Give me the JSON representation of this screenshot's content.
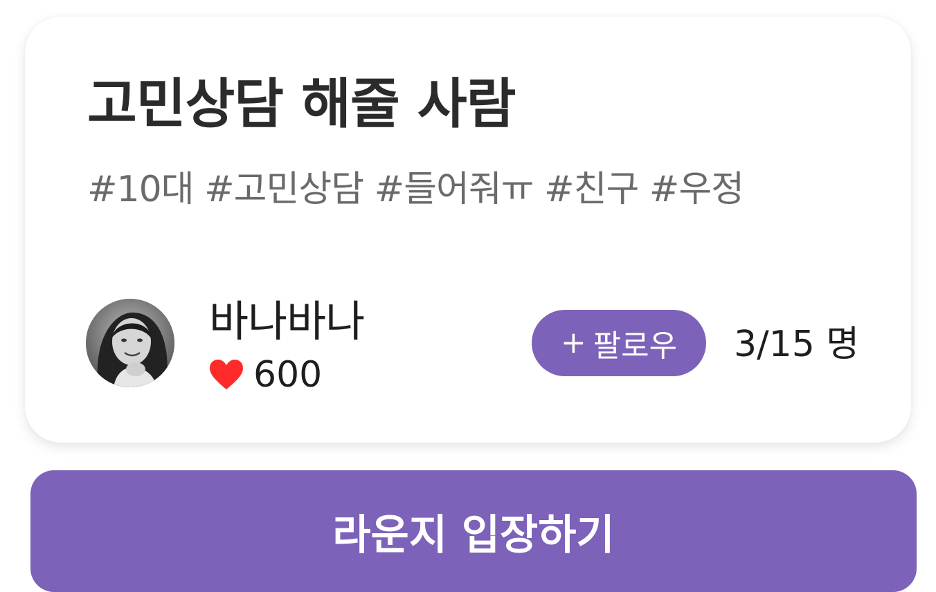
{
  "card": {
    "title": "고민상담 해줄 사람",
    "tags": "#10대 #고민상담 #들어줘ㅠ #친구 #우정",
    "host": {
      "avatar_icon": "profile-photo",
      "name": "바나바나",
      "like_icon": "heart-icon",
      "likes": "600"
    },
    "follow_button": {
      "icon": "+",
      "label": "팔로우"
    },
    "member_count": "3/15 명"
  },
  "enter_button": {
    "label": "라운지 입장하기"
  },
  "colors": {
    "accent": "#7c62b8",
    "heart": "#ff2a2a",
    "title_text": "#2b2b2b",
    "tag_text": "#6a6a6a"
  }
}
